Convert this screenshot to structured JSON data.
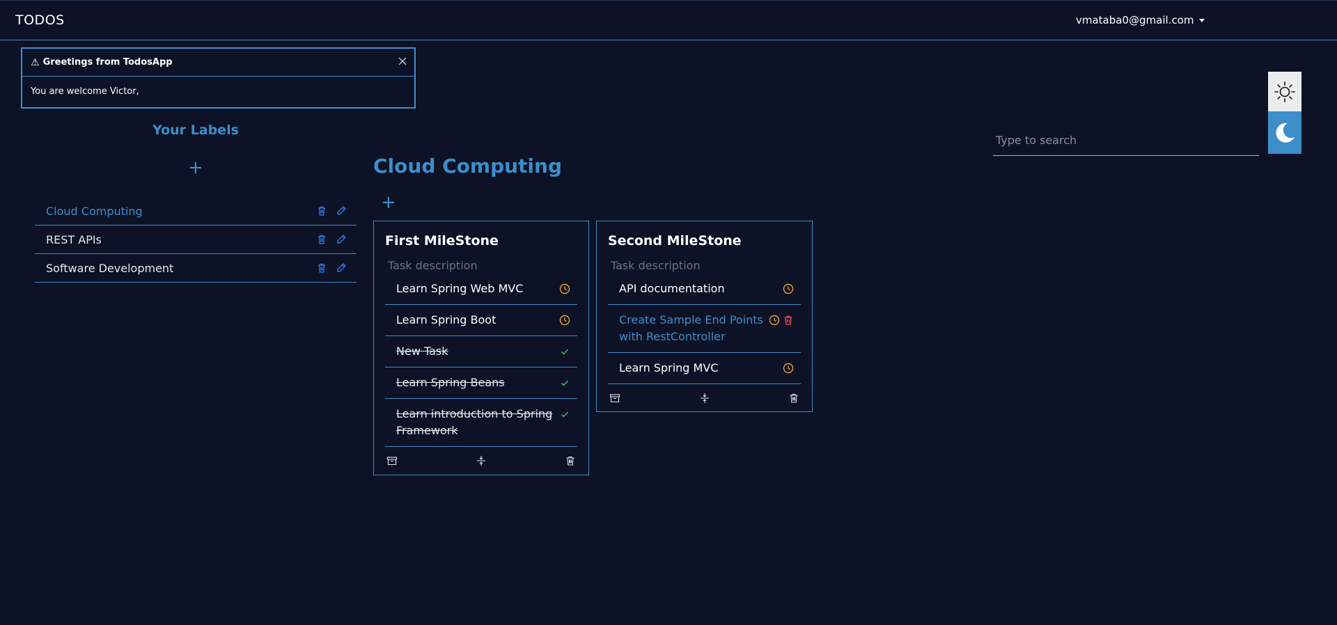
{
  "navbar": {
    "brand": "TODOS",
    "user_email": "vmataba0@gmail.com"
  },
  "toast": {
    "icon": "warning-icon",
    "title": "Greetings from TodosApp",
    "message": "You are welcome Victor,"
  },
  "labels": {
    "heading": "Your Labels",
    "items": [
      {
        "name": "Cloud Computing",
        "active": true
      },
      {
        "name": "REST APIs",
        "active": false
      },
      {
        "name": "Software Development",
        "active": false
      }
    ]
  },
  "board": {
    "title": "Cloud Computing",
    "task_placeholder": "Task description",
    "milestones": [
      {
        "title": "First MileStone",
        "tasks": [
          {
            "text": "Learn Spring Web MVC",
            "status": "pending"
          },
          {
            "text": "Learn Spring Boot",
            "status": "pending"
          },
          {
            "text": "New Task",
            "status": "done"
          },
          {
            "text": "Learn Spring Beans",
            "status": "done"
          },
          {
            "text": "Learn introduction to Spring Framework",
            "status": "done"
          }
        ]
      },
      {
        "title": "Second MileStone",
        "tasks": [
          {
            "text": "API documentation",
            "status": "pending"
          },
          {
            "text": "Create Sample End Points with RestController",
            "status": "pending"
          },
          {
            "text": "Learn Spring MVC",
            "status": "pending"
          }
        ]
      }
    ]
  },
  "search": {
    "placeholder": "Type to search"
  },
  "colors": {
    "background": "#0d1226",
    "accent": "#3d8ec9",
    "pending": "#e8a23a",
    "done": "#3fb96b",
    "delete": "#e04050",
    "label_icon": "#2f6fd8"
  }
}
